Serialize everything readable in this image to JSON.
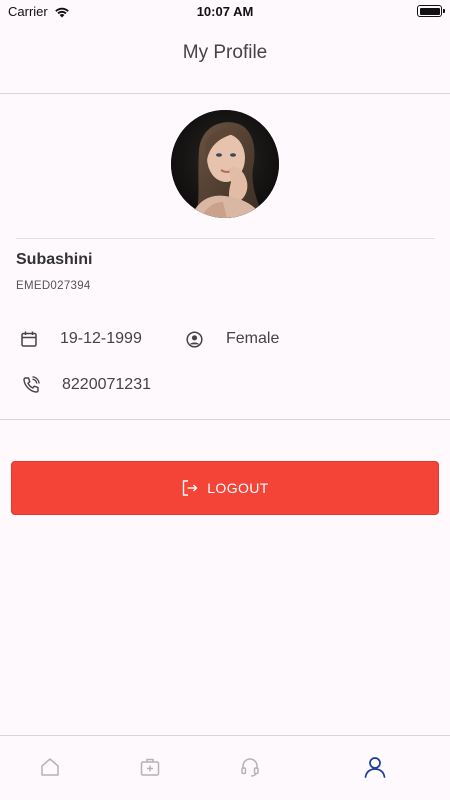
{
  "status_bar": {
    "carrier": "Carrier",
    "time": "10:07 AM"
  },
  "header": {
    "title": "My Profile"
  },
  "profile": {
    "name": "Subashini",
    "employee_id": "EMED027394",
    "dob": "19-12-1999",
    "gender": "Female",
    "phone": "8220071231"
  },
  "actions": {
    "logout_label": "LOGOUT"
  },
  "tab_bar": {
    "active_tab": "profile",
    "active_color": "#1c3e9a",
    "inactive_color": "#b4b4b4"
  },
  "colors": {
    "logout_bg": "#f44337",
    "background": "#fdf9fd"
  }
}
